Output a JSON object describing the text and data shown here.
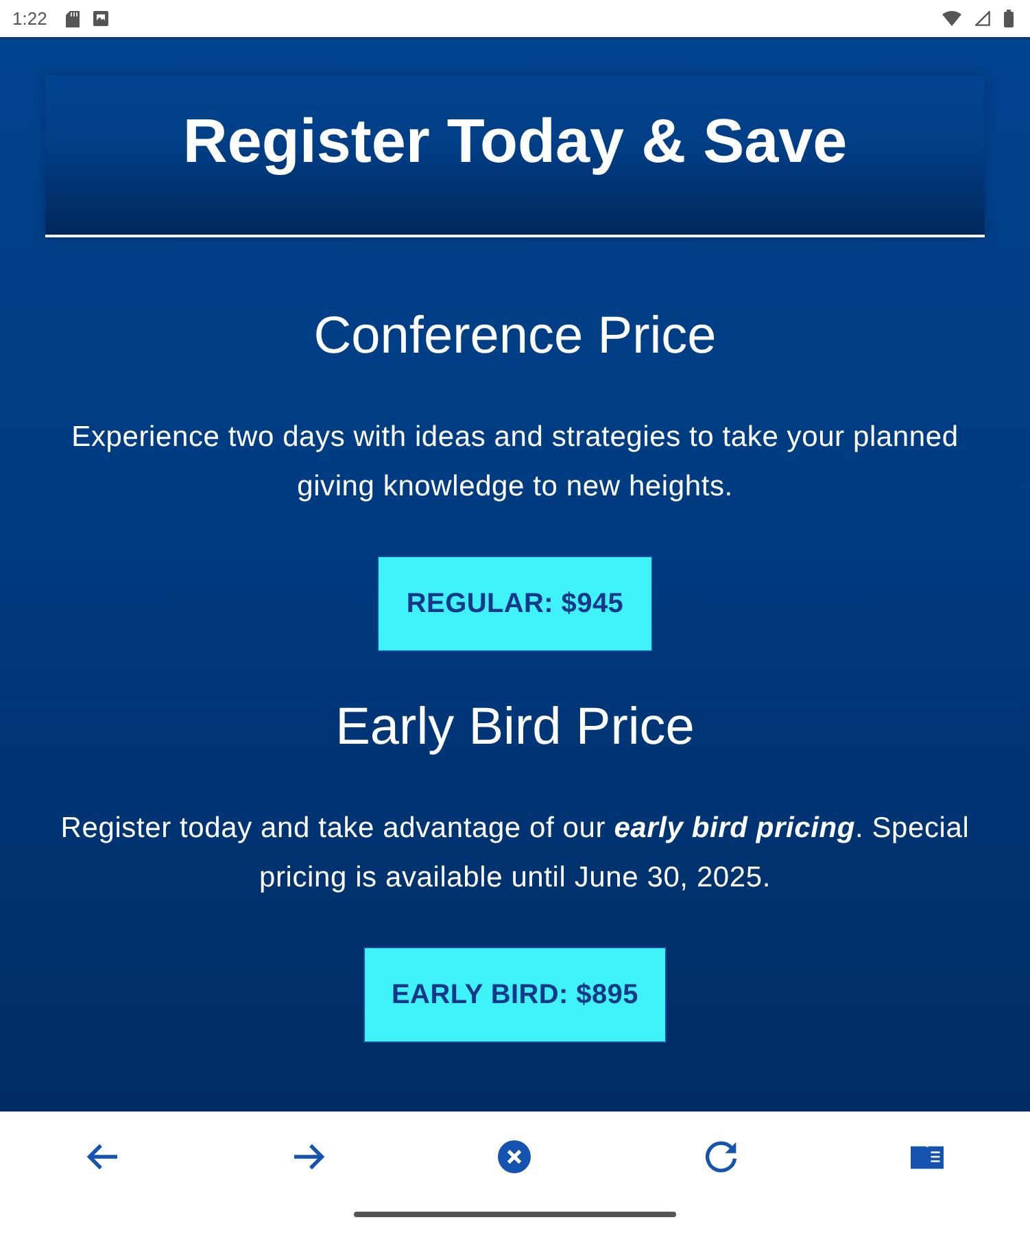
{
  "status_bar": {
    "time": "1:22"
  },
  "header": {
    "title": "Register Today & Save"
  },
  "sections": [
    {
      "heading": "Conference Price",
      "text": "Experience two days with ideas and strategies to take your planned giving knowledge to new heights.",
      "button": "REGULAR: $945"
    },
    {
      "heading": "Early Bird Price",
      "text": "Register today and take advantage of our **early bird pricing**. Special pricing is available until June 30, 2025.",
      "button": "EARLY BIRD: $895"
    }
  ],
  "nav_bar": [
    {
      "kind": "back"
    },
    {
      "kind": "forward"
    },
    {
      "kind": "stop"
    },
    {
      "kind": "reload"
    },
    {
      "kind": "reader"
    }
  ]
}
